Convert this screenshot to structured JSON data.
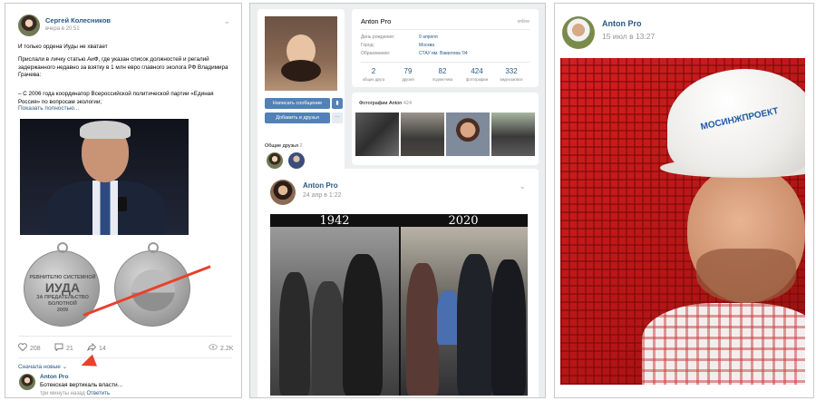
{
  "panel1": {
    "author": "Сергей Колесников",
    "time": "вчера в 20:51",
    "text_line1": "И только ордена Иуды не хватает",
    "text_line2": "Прислали в личку статью АиФ, где указан список должностей и регалий задержанного недавно за взятку в 1 млн евро главного эколога РФ Владимира Грачева:",
    "text_line3": "– С 2006 года координатор Всероссийской политической партии «Единая Россия» по вопросам экологии;",
    "show_more": "Показать полностью...",
    "medal_text_top": "РЕВНИТЕЛЮ СИСТЕМНОЙ",
    "medal_text_big": "ИУДА",
    "medal_text_bottom": "ЗА ПРЕДАТЕЛЬСТВО БОЛОТНОЙ",
    "medal_year": "2009",
    "likes": "208",
    "comments": "21",
    "shares": "14",
    "views": "2.2K",
    "sort_label": "Сначала новые ⌄",
    "comment_author": "Anton Pro",
    "comment_text": "Ботекская вертикаль власти...",
    "comment_time": "три минуты назад",
    "comment_reply": "Ответить",
    "accent_color": "#e8412c"
  },
  "panel2": {
    "name": "Anton Pro",
    "online": "online",
    "info": [
      {
        "label": "День рождения:",
        "value": "9 апреля"
      },
      {
        "label": "Город:",
        "value": "Москва"
      },
      {
        "label": "Образование:",
        "value": "СТАУ им. Вавилова '04"
      }
    ],
    "stats": [
      {
        "n": "2",
        "l": "общих друга"
      },
      {
        "n": "79",
        "l": "друзей"
      },
      {
        "n": "82",
        "l": "подписчика"
      },
      {
        "n": "424",
        "l": "фотографии"
      },
      {
        "n": "332",
        "l": "видеозаписи"
      }
    ],
    "write_button": "Написать сообщение",
    "add_button": "Добавить в друзья",
    "more_button": "···",
    "friends_title": "Общие друзья",
    "friends_count": "2",
    "photos_title": "Фотографии Anton",
    "photos_count": "424",
    "post_author": "Anton Pro",
    "post_time": "24 апр в 1:22",
    "year_left": "1942",
    "year_right": "2020"
  },
  "panel3": {
    "author": "Anton Pro",
    "time": "15 июл в 13:27",
    "helmet_logo": "МОСИНЖПРОЕКТ"
  }
}
